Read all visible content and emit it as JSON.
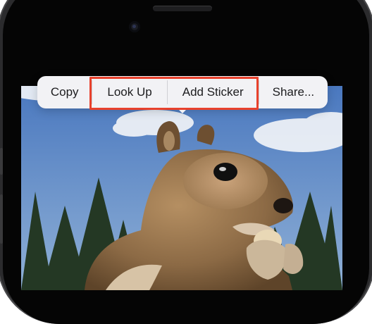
{
  "context_menu": {
    "items": [
      {
        "label": "Copy"
      },
      {
        "label": "Look Up"
      },
      {
        "label": "Add Sticker"
      },
      {
        "label": "Share..."
      }
    ]
  },
  "photo": {
    "subject": "squirrel-photo"
  },
  "colors": {
    "highlight": "#e8412c",
    "menu_bg": "#f2f2f5",
    "sky": "#5b86c4"
  }
}
